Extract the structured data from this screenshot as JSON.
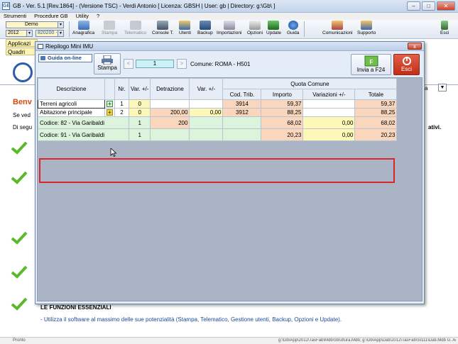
{
  "window": {
    "title": "GB - Ver. 5.1 [Rev.1864] - (Versione TSC) -  Verdi Antonio  [ Licenza: GBSH | User: gb | Directory: g:\\Gb\\ ]",
    "app_icon": "GB"
  },
  "menu": [
    "Strumenti",
    "Procedure GB",
    "Utility",
    "?"
  ],
  "toolbar": {
    "combo_main": "Demo",
    "combo_year": "2012",
    "combo_code": "820200 -",
    "buttons": [
      "Anagrafica",
      "Stampa",
      "Telematico",
      "Console T.",
      "Utenti",
      "Backup",
      "Importazioni",
      "Opzioni",
      "Update",
      "Guida",
      "Comunicazioni",
      "Supporto",
      "Esci"
    ]
  },
  "left_pane": [
    "Applicazi",
    "Quadri"
  ],
  "background": {
    "benv": "Benv",
    "se_ved": "Se ved",
    "di_segu": "Di segu",
    "ativi": "ativi.",
    "funzioni_title": "LE FUNZIONI ESSENZIALI",
    "funzioni_text": "- Utilizza il software al massimo delle sue potenzialità (Stampa, Telematico, Gestione utenti, Backup, Opzioni e Update).",
    "dropdown_text": "a",
    "status_left": "Pronto",
    "status_right": "g:\\Gb\\App\\2012\\TasFab\\Mdb\\Struttura.Mdb; g:\\Gb\\App\\Dati\\2012\\TasFab\\SI111\\Dati.Mdb G. Ag"
  },
  "dialog": {
    "title": "Riepilogo Mini IMU",
    "close": "x",
    "guida": "Guida on-line",
    "stampa": "Stampa",
    "prev": "<",
    "next": ">",
    "page": "1",
    "comune": "Comune: ROMA - H501",
    "invia": "Invia a F24",
    "esci": "Esci"
  },
  "table": {
    "headers": {
      "descrizione": "Descrizione",
      "nr": "Nr.",
      "var": "Var. +/-",
      "detrazione": "Detrazione",
      "var2": "Var. +/-",
      "quota": "Quota Comune",
      "cod": "Cod. Trib.",
      "importo": "Importo",
      "variazioni": "Variazioni +/-",
      "totale": "Totale"
    },
    "rows": [
      {
        "desc": "Terreni agricoli",
        "plus": "+",
        "nr": "1",
        "var": "0",
        "det": "",
        "var2": "",
        "cod": "3914",
        "imp": "59,37",
        "variaz": "",
        "tot": "59,37"
      },
      {
        "desc": "Abitazione principale",
        "plus": "+",
        "nr": "2",
        "var": "0",
        "det": "200,00",
        "var2": "0,00",
        "cod": "3912",
        "imp": "88,25",
        "variaz": "",
        "tot": "88,25"
      }
    ],
    "sub_rows": [
      {
        "desc": "Codice: 82 - Via Garibaldi",
        "var": "1",
        "det": "200",
        "imp": "68,02",
        "variaz": "0,00",
        "tot": "68,02"
      },
      {
        "desc": "Codice: 91 - Via Garibaldi",
        "var": "1",
        "det": "",
        "imp": "20,23",
        "variaz": "0,00",
        "tot": "20,23"
      }
    ]
  },
  "colors": {
    "highlight_border": "#d8262b",
    "yellow": "#fdf8b8",
    "salmon": "#f9d6bc",
    "green": "#dcf3dc",
    "page_box": "#c9f1f6"
  }
}
